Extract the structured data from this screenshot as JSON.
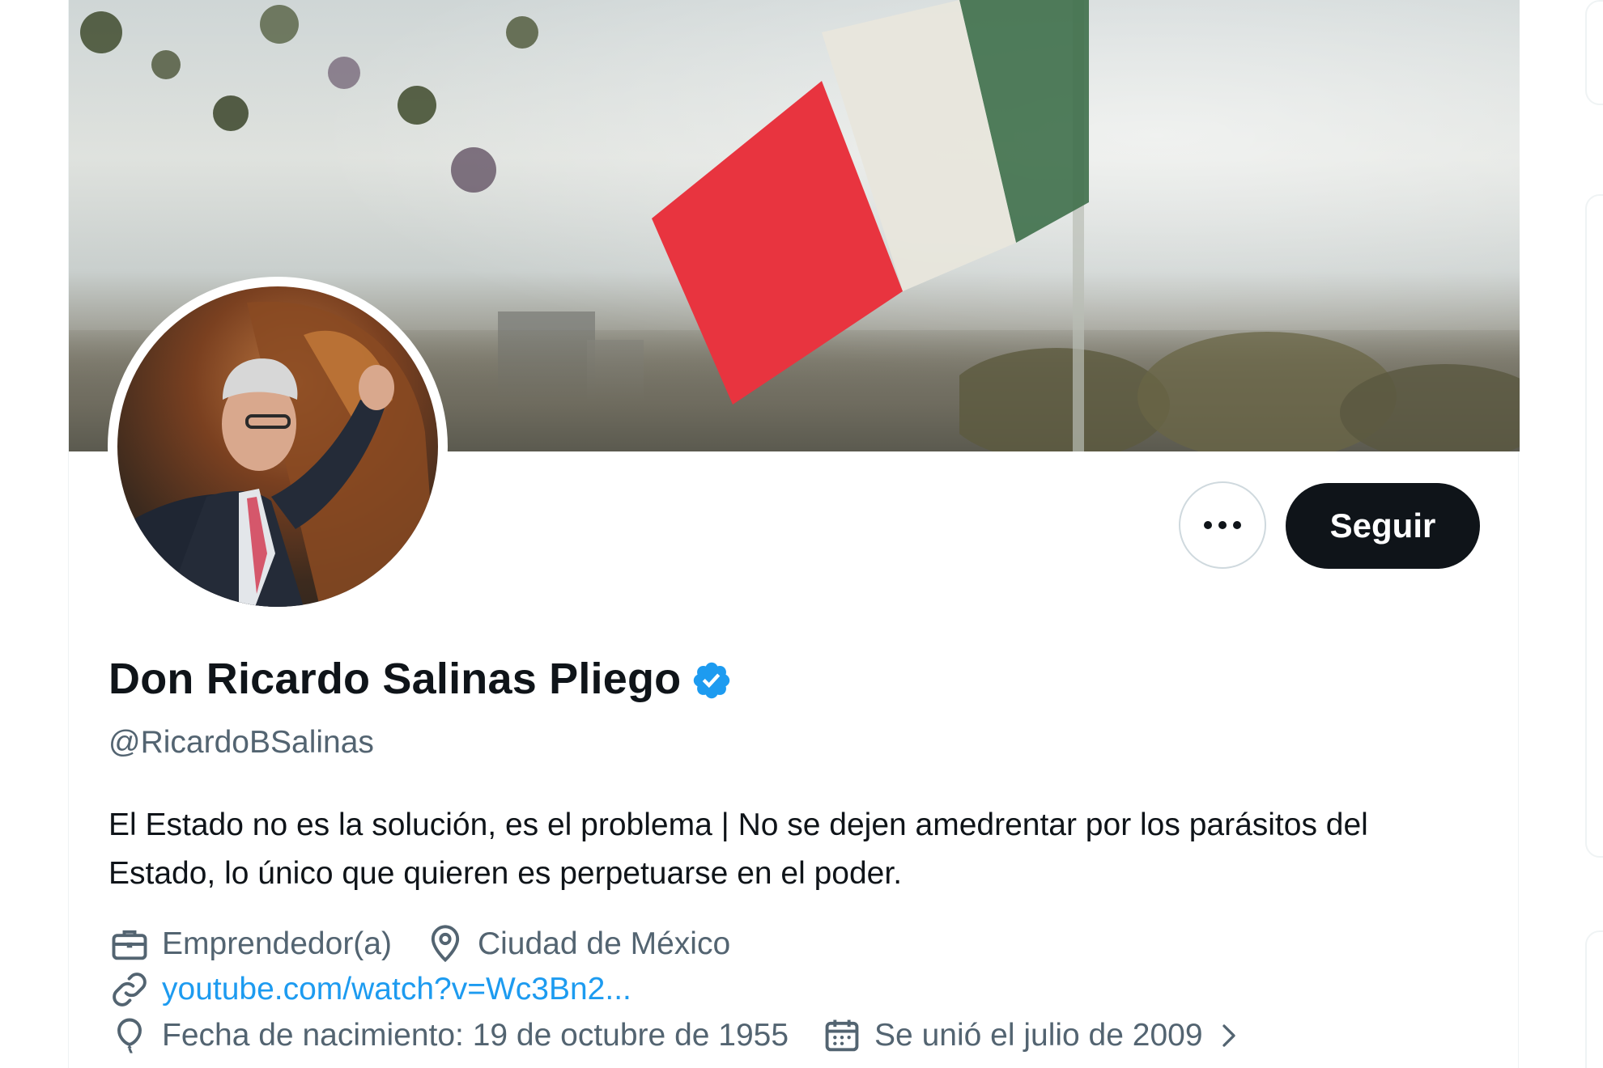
{
  "profile": {
    "display_name": "Don Ricardo Salinas Pliego",
    "handle": "@RicardoBSalinas",
    "bio": "El Estado no es la solución, es el problema | No se dejen amedrentar por los parásitos del Estado, lo único que quieren es perpetuarse en el poder.",
    "verified": true
  },
  "actions": {
    "more_label": "•••",
    "follow_label": "Seguir"
  },
  "meta": {
    "profession": "Emprendedor(a)",
    "location": "Ciudad de México",
    "website": "youtube.com/watch?v=Wc3Bn2...",
    "birthdate": "Fecha de nacimiento: 19 de octubre de 1955",
    "joined": "Se unió el julio de 2009"
  },
  "icons": {
    "profession": "briefcase-icon",
    "location": "map-pin-icon",
    "website": "link-icon",
    "birthdate": "balloon-icon",
    "joined": "calendar-icon",
    "verified": "verified-badge-icon"
  },
  "colors": {
    "accent": "#1d9bf0",
    "text": "#0f1419",
    "secondary": "#536471",
    "follow_bg": "#0f1419"
  }
}
